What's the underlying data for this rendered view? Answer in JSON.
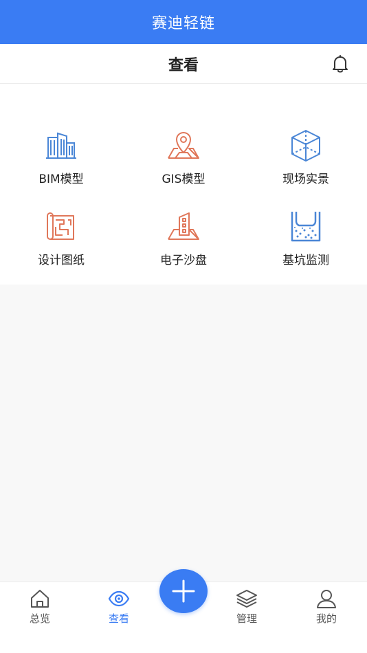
{
  "app": {
    "title": "赛迪轻链"
  },
  "header": {
    "title": "查看"
  },
  "colors": {
    "accent": "#3a7cf3",
    "blue_icon": "#4a86d6",
    "orange_icon": "#e0775a"
  },
  "grid": {
    "items": [
      {
        "label": "BIM模型",
        "icon": "buildings-icon"
      },
      {
        "label": "GIS模型",
        "icon": "map-pin-icon"
      },
      {
        "label": "现场实景",
        "icon": "cube-icon"
      },
      {
        "label": "设计图纸",
        "icon": "blueprint-icon"
      },
      {
        "label": "电子沙盘",
        "icon": "sandtable-icon"
      },
      {
        "label": "基坑监测",
        "icon": "foundation-pit-icon"
      }
    ]
  },
  "tabbar": {
    "tabs": [
      {
        "label": "总览",
        "icon": "home-icon",
        "active": false
      },
      {
        "label": "查看",
        "icon": "eye-icon",
        "active": true
      },
      {
        "label": "管理",
        "icon": "layers-icon",
        "active": false
      },
      {
        "label": "我的",
        "icon": "user-icon",
        "active": false
      }
    ],
    "fab_icon": "plus-icon"
  }
}
